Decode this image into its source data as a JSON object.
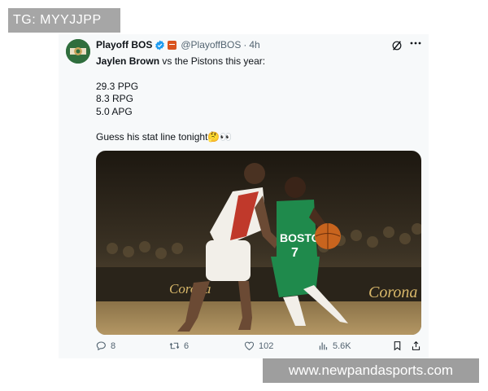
{
  "watermarks": {
    "top_left": "TG: MYYJJPP",
    "bottom_right": "www.newpandasports.com"
  },
  "tweet": {
    "display_name": "Playoff BOS",
    "handle": "@PlayoffBOS",
    "separator": "·",
    "time": "4h",
    "line1_name": "Jaylen Brown",
    "line1_rest": " vs the Pistons this year:",
    "stats": [
      "29.3 PPG",
      "8.3 RPG",
      "5.0 APG"
    ],
    "closing": "Guess his stat line tonight🤔👀",
    "media": {
      "jersey_team": "BOSTON",
      "jersey_number": "7",
      "ad_text": "Corona"
    }
  },
  "icons": {
    "verified": "verified-badge-icon",
    "flag": "affiliate-flag-icon",
    "grok": "grok-icon",
    "more": "more-options-icon",
    "reply": "reply-icon",
    "repost": "repost-icon",
    "like": "like-icon",
    "views": "views-icon",
    "bookmark": "bookmark-icon",
    "share": "share-icon"
  },
  "colors": {
    "verified_blue": "#1d9bf0",
    "text_primary": "#0f1419",
    "text_secondary": "#536471",
    "celtics_green": "#1f8a4c"
  },
  "actions": {
    "replies": "8",
    "reposts": "6",
    "likes": "102",
    "views": "5.6K"
  }
}
